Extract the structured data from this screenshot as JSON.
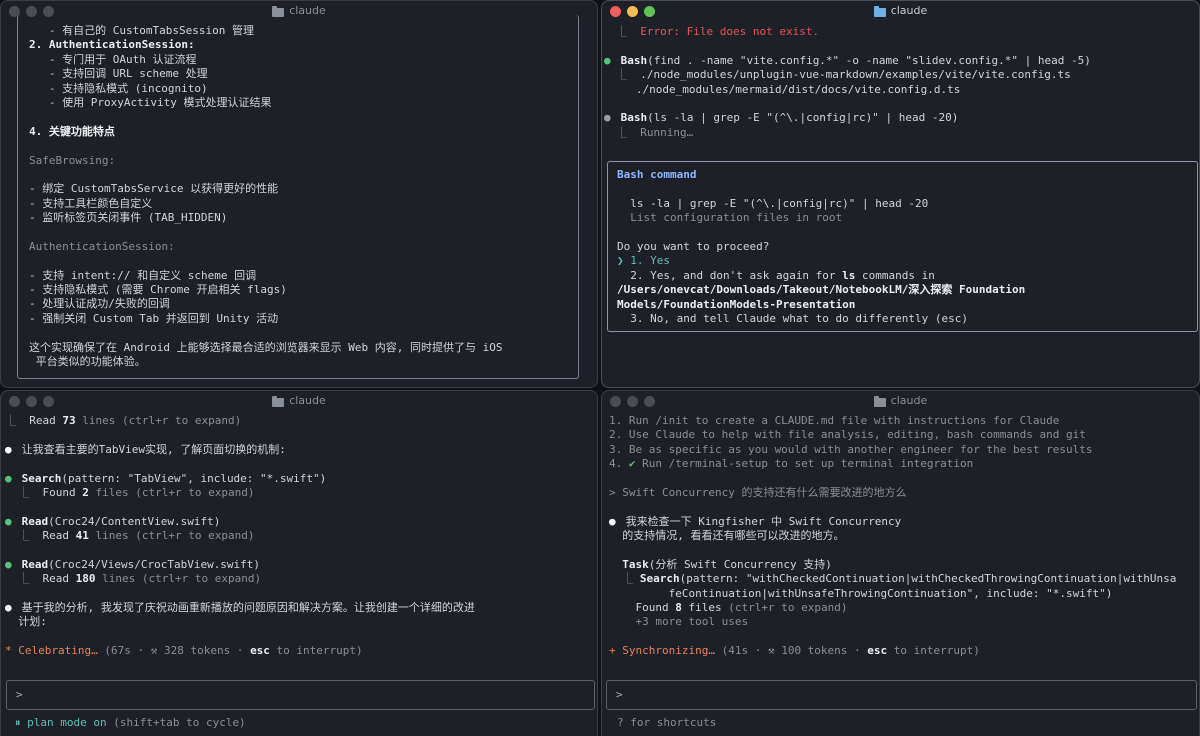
{
  "windows": {
    "tl": {
      "title": "claude",
      "lines": [
        "   - 有自己的 CustomTabsSession 管理",
        "2. AuthenticationSession:",
        "   - 专门用于 OAuth 认证流程",
        "   - 支持回调 URL scheme 处理",
        "   - 支持隐私模式 (incognito)",
        "   - 使用 ProxyActivity 模式处理认证结果",
        "",
        "4. 关键功能特点",
        "",
        "SafeBrowsing:",
        "",
        "- 绑定 CustomTabsService 以获得更好的性能",
        "- 支持工具栏颜色自定义",
        "- 监听标签页关闭事件 (TAB_HIDDEN)",
        "",
        "AuthenticationSession:",
        "",
        "- 支持 intent:// 和自定义 scheme 回调",
        "- 支持隐私模式 (需要 Chrome 开启相关 flags)",
        "- 处理认证成功/失败的回调",
        "- 强制关闭 Custom Tab 并返回到 Unity 活动",
        "",
        "这个实现确保了在 Android 上能够选择最合适的浏览器来显示 Web 内容, 同时提供了与 iOS",
        " 平台类似的功能体验。"
      ]
    },
    "tr": {
      "title": "claude",
      "error_line": "Error: File does not exist.",
      "bash1_cmd": "Bash",
      "bash1_args": "(find . -name \"vite.config.*\" -o -name \"slidev.config.*\" | head -5)",
      "bash1_out1": "./node_modules/unplugin-vue-markdown/examples/vite/vite.config.ts",
      "bash1_out2": "./node_modules/mermaid/dist/docs/vite.config.d.ts",
      "bash2_cmd": "Bash",
      "bash2_args": "(ls -la | grep -E \"(^\\.|config|rc)\" | head -20)",
      "bash2_status": "Running…",
      "dialog": {
        "title": "Bash command",
        "command": "ls -la | grep -E \"(^\\.|config|rc)\" | head -20",
        "description": "List configuration files in root",
        "question": "Do you want to proceed?",
        "opt1": "1. Yes",
        "opt2a": "2. Yes, and don't ask again for ",
        "opt2cmd": "ls",
        "opt2b": " commands in",
        "opt2path1": "/Users/onevcat/Downloads/Takeout/NotebookLM/深入探索 Foundation",
        "opt2path2": "Models/FoundationModels-Presentation",
        "opt3": "3. No, and tell Claude what to do differently (esc)"
      }
    },
    "bl": {
      "title": "claude",
      "read0": "Read ",
      "read0_n": "73",
      "read0_tail": " lines (ctrl+r to expand)",
      "msg1": "让我查看主要的TabView实现, 了解页面切换的机制:",
      "search_cmd": "Search",
      "search_args": "(pattern: \"TabView\", include: \"*.swift\")",
      "search_found": "Found ",
      "search_n": "2",
      "search_tail": " files (ctrl+r to expand)",
      "read1_cmd": "Read",
      "read1_args": "(Croc24/ContentView.swift)",
      "read1_n": "41",
      "read2_cmd": "Read",
      "read2_args": "(Croc24/Views/CrocTabView.swift)",
      "read2_n": "180",
      "lines_label": " lines (ctrl+r to expand)",
      "read_label": "Read ",
      "msg2a": "基于我的分析, 我发现了庆祝动画重新播放的问题原因和解决方案。让我创建一个详细的改进",
      "msg2b": "计划:",
      "status_word": "Celebrating…",
      "status_a": " (67s · ⚒ 328 tokens · ",
      "status_esc": "esc",
      "status_b": " to interrupt)",
      "prompt": ">",
      "mode_on": "plan mode on",
      "mode_hint": " (shift+tab to cycle)"
    },
    "br": {
      "title": "claude",
      "tips": [
        "1. Run /init to create a CLAUDE.md file with instructions for Claude",
        "2. Use Claude to help with file analysis, editing, bash commands and git",
        "3. Be as specific as you would with another engineer for the best results"
      ],
      "tip4": "Run /terminal-setup to set up terminal integration",
      "tip4_num": "4. ",
      "user_prompt": "> Swift Concurrency 的支持还有什么需要改进的地方么",
      "reply1": "我来检查一下 Kingfisher 中 Swift Concurrency",
      "reply2": "的支持情况, 看看还有哪些可以改进的地方。",
      "task_cmd": "Task",
      "task_args": "(分析 Swift Concurrency 支持)",
      "search_cmd": "Search",
      "search_args1": "(pattern: \"withCheckedContinuation|withCheckedThrowingContinuation|withUnsa",
      "search_args2": "feContinuation|withUnsafeThrowingContinuation\", include: \"*.swift\")",
      "found_a": "Found ",
      "found_n": "8",
      "found_b": " files",
      "found_hint": " (ctrl+r to expand)",
      "more": "+3 more tool uses",
      "status_word": "Synchronizing…",
      "status_a": " (41s · ⚒ 100 tokens · ",
      "status_esc": "esc",
      "status_b": " to interrupt)",
      "prompt": ">",
      "shortcuts": "? for shortcuts"
    }
  }
}
